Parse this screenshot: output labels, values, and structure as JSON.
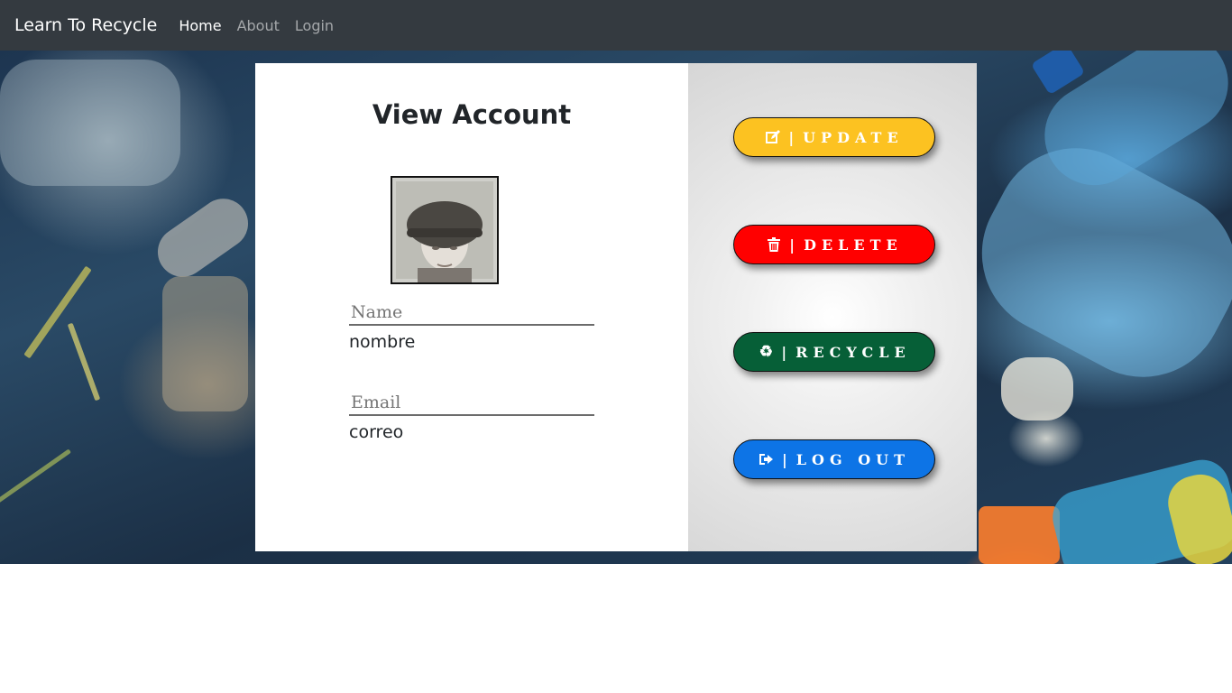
{
  "navbar": {
    "brand": "Learn To Recycle",
    "links": [
      {
        "label": "Home",
        "active": true
      },
      {
        "label": "About",
        "active": false
      },
      {
        "label": "Login",
        "active": false
      }
    ]
  },
  "account": {
    "title": "View Account",
    "fields": [
      {
        "label": "Name",
        "value": "nombre"
      },
      {
        "label": "Email",
        "value": "correo"
      }
    ]
  },
  "actions": [
    {
      "label": "UPDATE",
      "separator": "|",
      "icon": "edit-icon",
      "color": "#fcc221",
      "text_color": "#ffffff"
    },
    {
      "label": "DELETE",
      "separator": "|",
      "icon": "trash-icon",
      "color": "#ff0000",
      "text_color": "#ffffff"
    },
    {
      "label": "RECYCLE",
      "separator": "|",
      "icon": "recycle-icon",
      "color": "#065f37",
      "text_color": "#ffffff"
    },
    {
      "label": "LOG OUT",
      "separator": "|",
      "icon": "sign-out-icon",
      "color": "#0d74e6",
      "text_color": "#ffffff"
    }
  ],
  "colors": {
    "navbar_bg": "#343a40",
    "card_bg": "#ffffff"
  }
}
